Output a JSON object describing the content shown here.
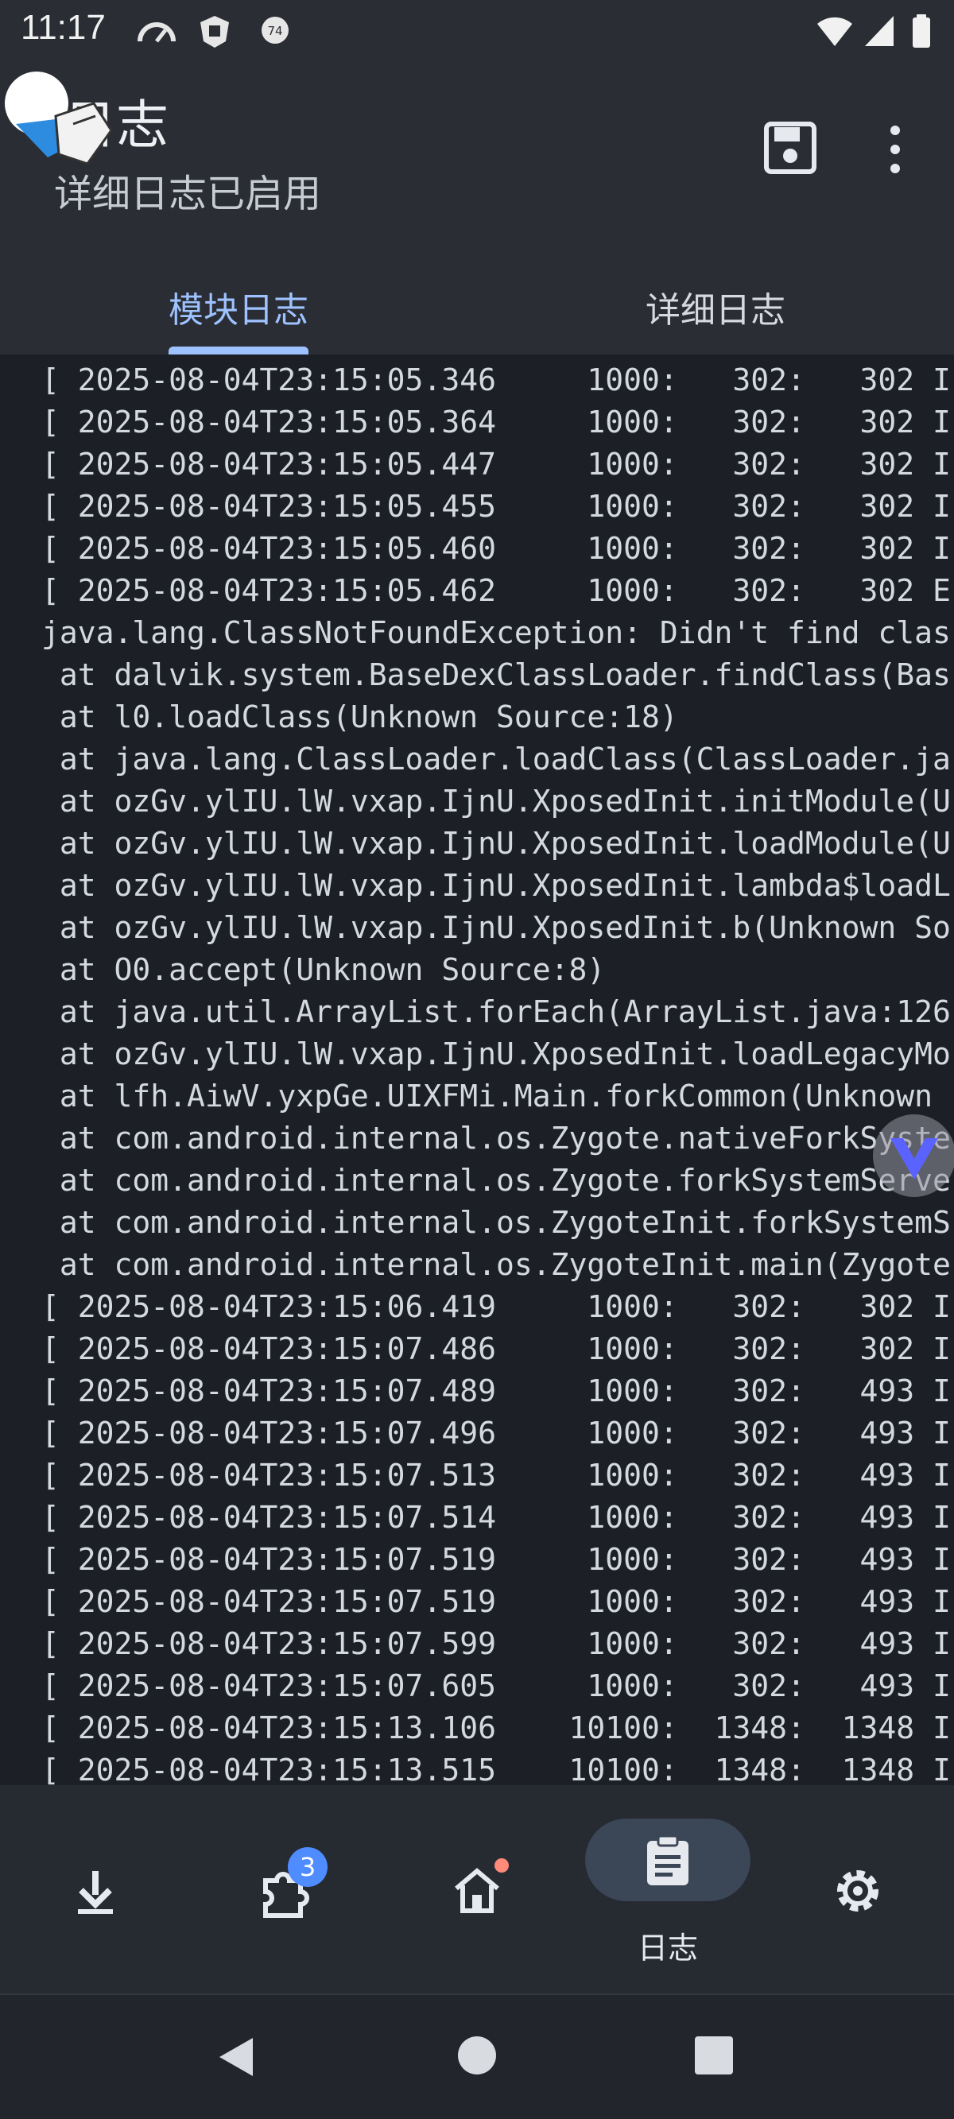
{
  "status_bar": {
    "time": "11:17",
    "notification_icons": [
      "speedometer-icon",
      "shield-app-icon",
      "notification-74-icon"
    ],
    "system_icons": [
      "wifi-icon",
      "signal-icon",
      "battery-icon"
    ]
  },
  "app_bar": {
    "title": "日志",
    "subtitle": "详细日志已启用",
    "actions": [
      "save-icon",
      "more-vert-icon"
    ]
  },
  "tabs": [
    {
      "label": "模块日志",
      "active": true
    },
    {
      "label": "详细日志",
      "active": false
    }
  ],
  "log_lines": [
    "[ 2025-08-04T23:15:05.346     1000:   302:   302 I",
    "[ 2025-08-04T23:15:05.364     1000:   302:   302 I",
    "[ 2025-08-04T23:15:05.447     1000:   302:   302 I",
    "[ 2025-08-04T23:15:05.455     1000:   302:   302 I",
    "[ 2025-08-04T23:15:05.460     1000:   302:   302 I",
    "[ 2025-08-04T23:15:05.462     1000:   302:   302 E",
    "java.lang.ClassNotFoundException: Didn't find clas",
    " at dalvik.system.BaseDexClassLoader.findClass(Bas",
    " at l0.loadClass(Unknown Source:18)",
    " at java.lang.ClassLoader.loadClass(ClassLoader.ja",
    " at ozGv.ylIU.lW.vxap.IjnU.XposedInit.initModule(U",
    " at ozGv.ylIU.lW.vxap.IjnU.XposedInit.loadModule(U",
    " at ozGv.ylIU.lW.vxap.IjnU.XposedInit.lambda$loadL",
    " at ozGv.ylIU.lW.vxap.IjnU.XposedInit.b(Unknown So",
    " at O0.accept(Unknown Source:8)",
    " at java.util.ArrayList.forEach(ArrayList.java:126",
    " at ozGv.ylIU.lW.vxap.IjnU.XposedInit.loadLegacyMo",
    " at lfh.AiwV.yxpGe.UIXFMi.Main.forkCommon(Unknown ",
    " at com.android.internal.os.Zygote.nativeForkSyste",
    " at com.android.internal.os.Zygote.forkSystemServe",
    " at com.android.internal.os.ZygoteInit.forkSystemS",
    " at com.android.internal.os.ZygoteInit.main(Zygote",
    "[ 2025-08-04T23:15:06.419     1000:   302:   302 I",
    "[ 2025-08-04T23:15:07.486     1000:   302:   302 I",
    "[ 2025-08-04T23:15:07.489     1000:   302:   493 I",
    "[ 2025-08-04T23:15:07.496     1000:   302:   493 I",
    "[ 2025-08-04T23:15:07.513     1000:   302:   493 I",
    "[ 2025-08-04T23:15:07.514     1000:   302:   493 I",
    "[ 2025-08-04T23:15:07.519     1000:   302:   493 I",
    "[ 2025-08-04T23:15:07.519     1000:   302:   493 I",
    "[ 2025-08-04T23:15:07.599     1000:   302:   493 I",
    "[ 2025-08-04T23:15:07.605     1000:   302:   493 I",
    "[ 2025-08-04T23:15:13.106    10100:  1348:  1348 I",
    "[ 2025-08-04T23:15:13.515    10100:  1348:  1348 I"
  ],
  "bottom_nav": {
    "items": [
      {
        "icon": "download-icon",
        "label": ""
      },
      {
        "icon": "extension-icon",
        "label": "",
        "badge": "3"
      },
      {
        "icon": "home-icon",
        "label": "",
        "dot": true
      },
      {
        "icon": "log-clipboard-icon",
        "label": "日志",
        "active": true
      },
      {
        "icon": "settings-icon",
        "label": ""
      }
    ]
  },
  "colors": {
    "accent": "#9ec2ff",
    "background": "#1c1f26",
    "appbar": "#2a2d33",
    "badge": "#4e8cff",
    "dot": "#ff8a7a"
  }
}
